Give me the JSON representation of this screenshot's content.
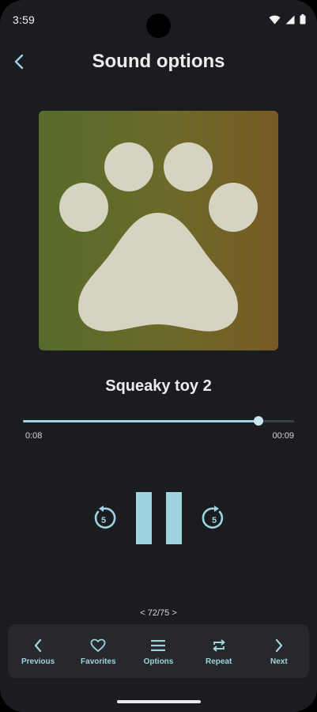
{
  "status_bar": {
    "time": "3:59"
  },
  "header": {
    "title": "Sound options"
  },
  "track": {
    "title": "Squeaky toy 2",
    "elapsed": "0:08",
    "total": "00:09",
    "progress": 0.87
  },
  "controls": {
    "rewind_seconds": "5",
    "forward_seconds": "5"
  },
  "pager": {
    "text": "< 72/75 >"
  },
  "bottom_nav": {
    "items": [
      {
        "label": "Previous",
        "icon": "chevron-left-icon"
      },
      {
        "label": "Favorites",
        "icon": "heart-icon"
      },
      {
        "label": "Options",
        "icon": "menu-icon"
      },
      {
        "label": "Repeat",
        "icon": "repeat-icon"
      },
      {
        "label": "Next",
        "icon": "chevron-right-icon"
      }
    ]
  },
  "colors": {
    "background": "#1b1c20",
    "accent": "#9ed3df",
    "nav_background": "#26282b",
    "paw": "#d6d4c1"
  }
}
